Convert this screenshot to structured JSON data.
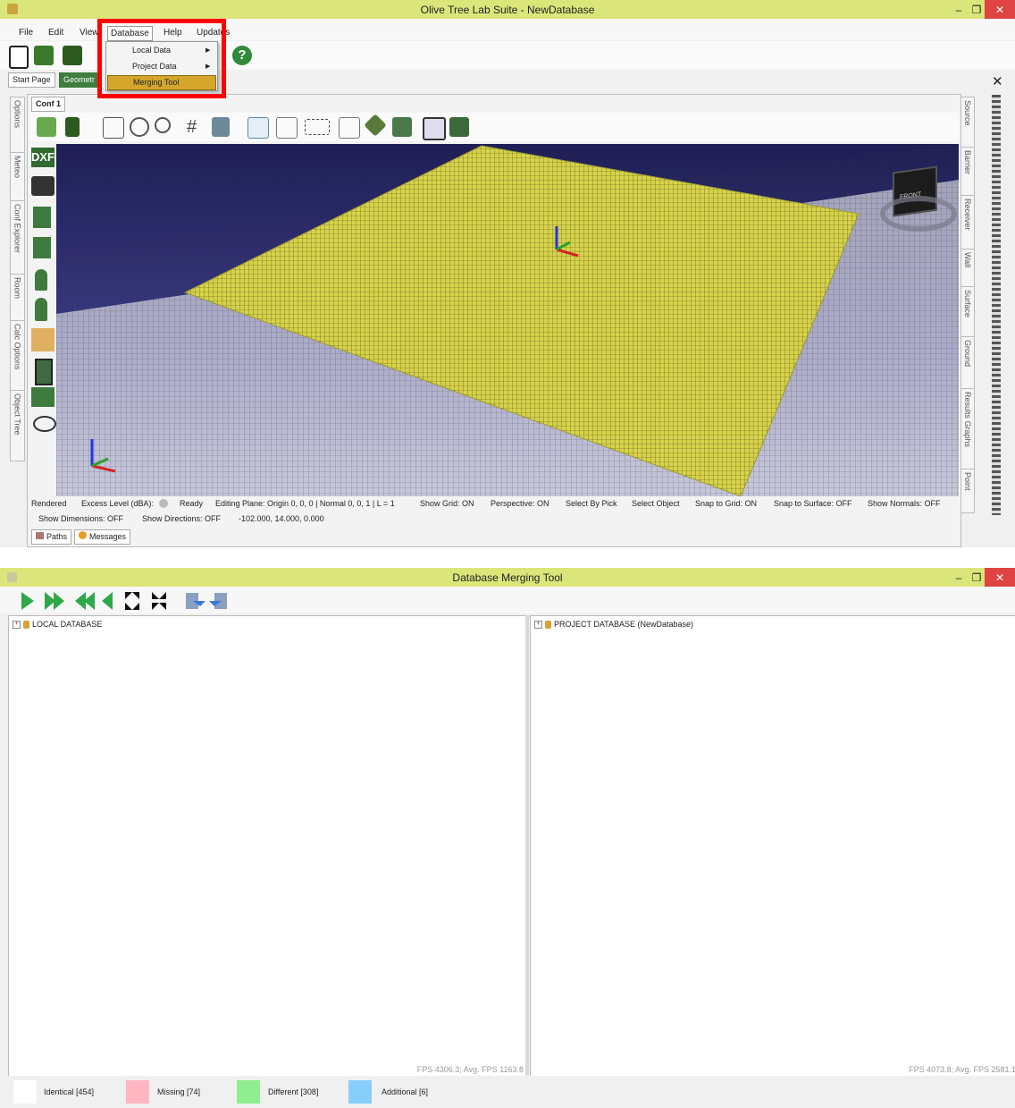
{
  "main_window": {
    "title": "Olive Tree Lab Suite - NewDatabase",
    "menu": [
      "File",
      "Edit",
      "View",
      "Database",
      "Help",
      "Updates"
    ],
    "database_menu": [
      "Local Data",
      "Project Data",
      "Merging Tool"
    ],
    "tabs": [
      "Start Page",
      "Geometr"
    ],
    "conf_tab": "Conf 1",
    "left_side_tabs": [
      "Options",
      "Meteo",
      "Conf Explorer",
      "Room",
      "Calc Options",
      "Object Tree"
    ],
    "right_side_tabs": [
      "Source",
      "Barrier",
      "Receiver",
      "Wall",
      "Surface",
      "Ground",
      "Results Graphs",
      "Point"
    ],
    "dxf_label": "DXF",
    "nav_cube_label": "FRONT",
    "status": {
      "line1": [
        "Rendered",
        "Excess Level (dBA):",
        "Ready",
        "Editing Plane: Origin 0, 0, 0 | Normal 0, 0, 1 | L = 1",
        "Show Grid: ON",
        "Perspective: ON",
        "Select By Pick",
        "Select Object",
        "Snap to Grid: ON",
        "Snap to Surface: OFF",
        "Show Normals: OFF"
      ],
      "line2": [
        "Show Dimensions: OFF",
        "Show Directions: OFF",
        "-102.000, 14.000, 0.000"
      ]
    },
    "bottom_tabs": [
      "Paths",
      "Messages"
    ]
  },
  "merge_window": {
    "title": "Database Merging Tool",
    "left_tree": "LOCAL DATABASE",
    "right_tree": "PROJECT DATABASE (NewDatabase)",
    "left_fps": "FPS 4306.3; Avg. FPS 1163.8",
    "right_fps": "FPS 4073.8; Avg. FPS 2581.1",
    "legend": [
      {
        "label": "Identical [454]",
        "color": "#ffffff"
      },
      {
        "label": "Missing [74]",
        "color": "#ffb6c1"
      },
      {
        "label": "Different [308]",
        "color": "#90ee90"
      },
      {
        "label": "Additional [6]",
        "color": "#87cefa"
      }
    ]
  },
  "colors": {
    "titlebar": "#dbe67a",
    "highlight_box": "#ff0000",
    "menu_selected": "#d4a72c",
    "viewport_sky": "#2a2a66",
    "ground_plane": "#d6d24a"
  }
}
